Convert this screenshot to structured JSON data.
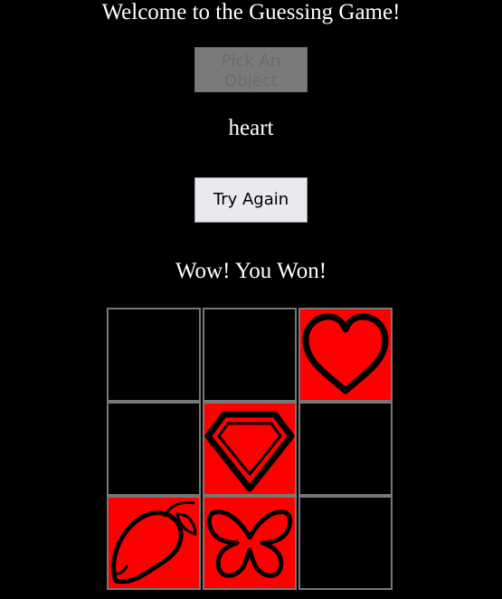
{
  "title": "Welcome to the Guessing Game!",
  "pick_button": {
    "label": "Pick An Object",
    "disabled": true
  },
  "current_object": "heart",
  "try_again_button": {
    "label": "Try Again"
  },
  "result_message": "Wow! You Won!",
  "colors": {
    "background": "#000000",
    "revealed_tile": "#ff0000",
    "hidden_tile": "#000000",
    "tile_border": "#777777",
    "icon_stroke": "#000000"
  },
  "grid": {
    "rows": 3,
    "cols": 3,
    "cells": [
      {
        "icon": null,
        "revealed": false
      },
      {
        "icon": null,
        "revealed": false
      },
      {
        "icon": "heart-icon",
        "revealed": true
      },
      {
        "icon": null,
        "revealed": false
      },
      {
        "icon": "diamond-icon",
        "revealed": true
      },
      {
        "icon": null,
        "revealed": false
      },
      {
        "icon": "mango-icon",
        "revealed": true
      },
      {
        "icon": "butterfly-icon",
        "revealed": true
      },
      {
        "icon": null,
        "revealed": false
      }
    ]
  }
}
